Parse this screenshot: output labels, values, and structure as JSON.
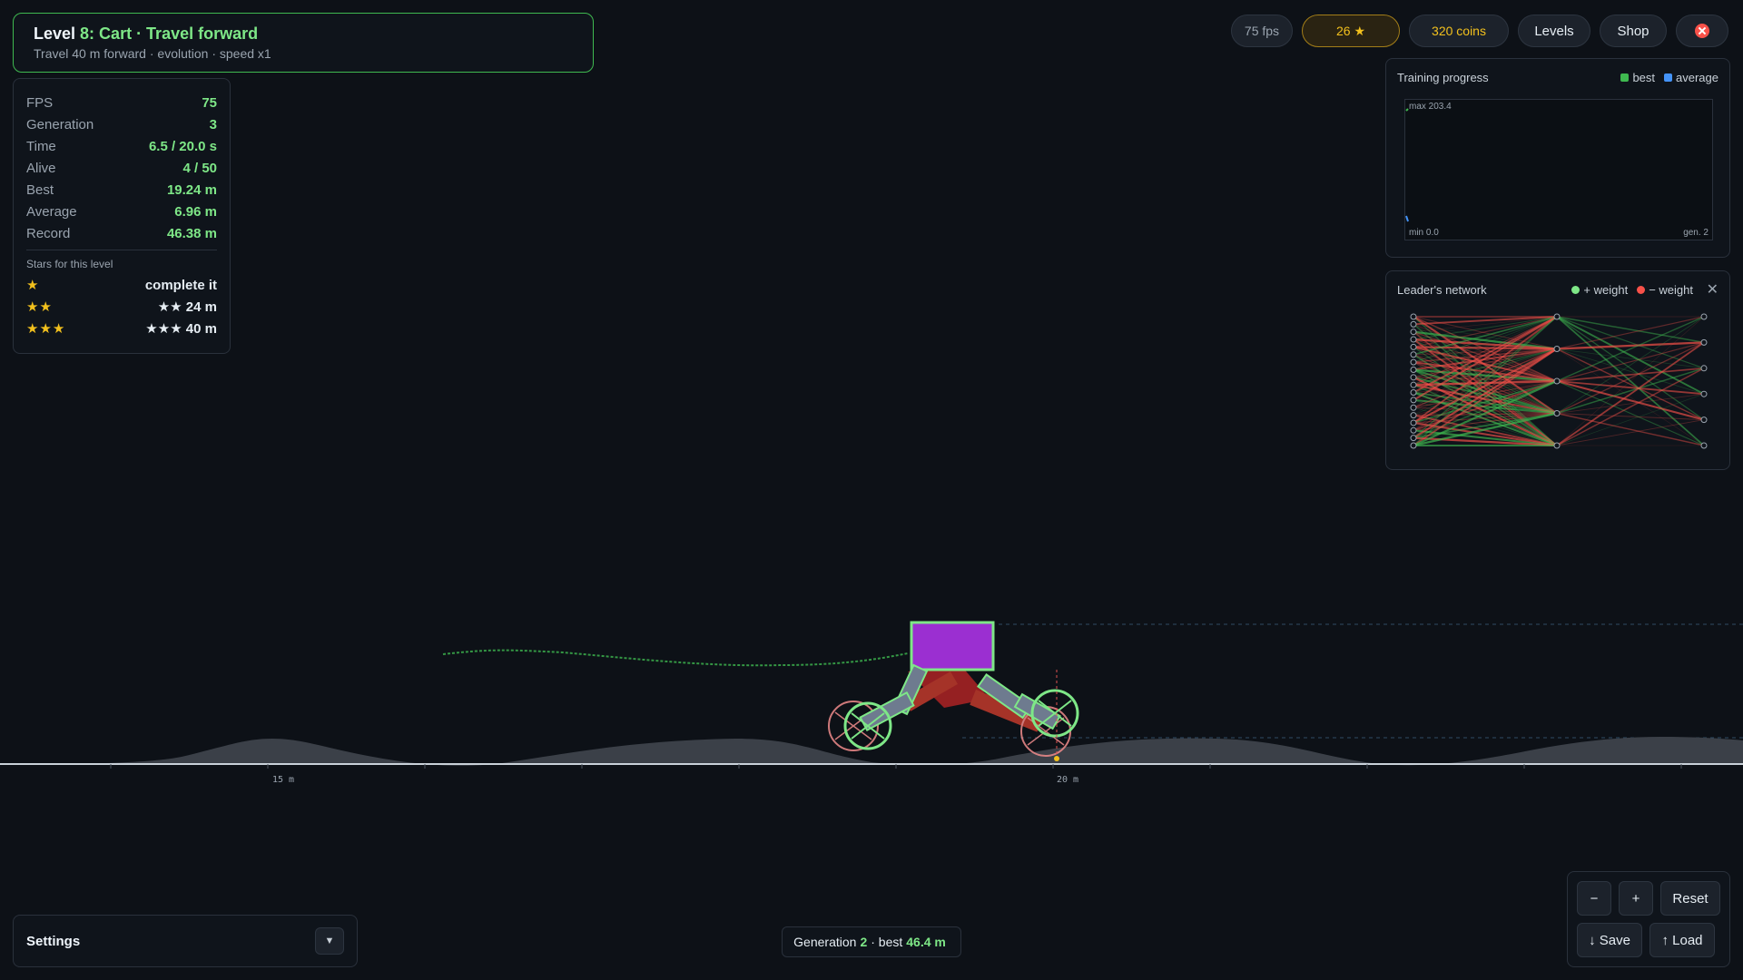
{
  "level": {
    "prefix": "Level",
    "name": "8: Cart · Travel forward",
    "subtitle": "Travel 40 m forward · evolution · speed x1"
  },
  "stats": [
    {
      "key": "FPS",
      "value": "75"
    },
    {
      "key": "Generation",
      "value": "3"
    },
    {
      "key": "Time",
      "value": "6.5 / 20.0 s"
    },
    {
      "key": "Alive",
      "value": "4 / 50"
    },
    {
      "key": "Best",
      "value": "19.24 m"
    },
    {
      "key": "Average",
      "value": "6.96 m"
    },
    {
      "key": "Record",
      "value": "46.38 m"
    }
  ],
  "stars_section": {
    "heading": "Stars for this level",
    "rows": [
      {
        "stars": "★",
        "requirement": "complete it"
      },
      {
        "stars": "★★",
        "requirement": "★★ 24 m"
      },
      {
        "stars": "★★★",
        "requirement": "★★★ 40 m"
      }
    ]
  },
  "topbar": {
    "fps": "75 fps",
    "stars": "26 ★",
    "coins": "320 coins",
    "levels": "Levels",
    "shop": "Shop"
  },
  "training": {
    "title": "Training progress",
    "legend_best": "best",
    "legend_average": "average",
    "max_label": "max 203.4",
    "min_label": "min 0.0",
    "gen_label": "gen. 2"
  },
  "network": {
    "title": "Leader's network",
    "legend_pos": "+ weight",
    "legend_neg": "− weight",
    "close": "✕"
  },
  "world": {
    "tick_15": "15 m",
    "tick_20": "20 m"
  },
  "settings": {
    "label": "Settings",
    "toggle": "▼"
  },
  "generation_status": {
    "prefix": "Generation",
    "gen": "2",
    "middle": "· best",
    "best": "46.4 m"
  },
  "zoom": {
    "minus": "−",
    "plus": "+",
    "reset": "Reset",
    "save": "↓ Save",
    "load": "↑ Load"
  },
  "colors": {
    "accent_green": "#7ee787",
    "star_gold": "#f2c01d",
    "best_series": "#3fb950",
    "average_series": "#4493f8",
    "body_purple": "#9b2fd1",
    "negative_red": "#f85149"
  }
}
